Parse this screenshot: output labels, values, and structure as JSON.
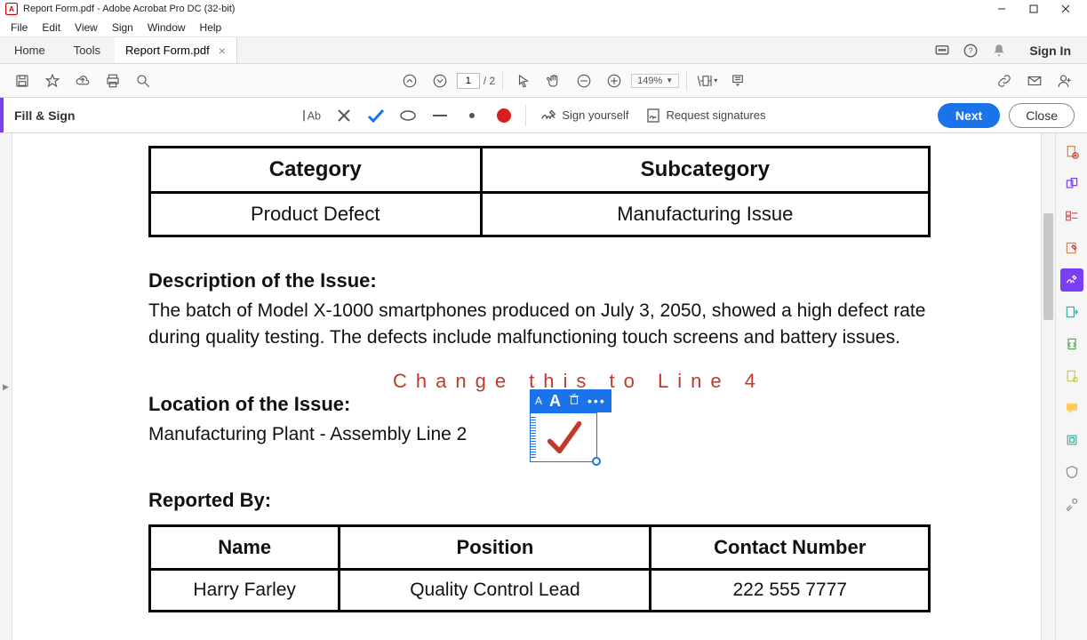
{
  "window": {
    "title": "Report Form.pdf - Adobe Acrobat Pro DC (32-bit)"
  },
  "menu": {
    "file": "File",
    "edit": "Edit",
    "view": "View",
    "sign": "Sign",
    "window": "Window",
    "help": "Help"
  },
  "tabs": {
    "home": "Home",
    "tools": "Tools",
    "doc": "Report Form.pdf",
    "signin": "Sign In"
  },
  "toolbar": {
    "page_current": "1",
    "page_total": "/ 2",
    "zoom": "149%"
  },
  "fillsign": {
    "label": "Fill & Sign",
    "sign_yourself": "Sign yourself",
    "request": "Request signatures",
    "next": "Next",
    "close": "Close"
  },
  "annot": {
    "overlay_text": "Change this to Line 4",
    "small_a": "A",
    "big_a": "A",
    "dots": "•••"
  },
  "doc": {
    "cat_header": "Category",
    "subcat_header": "Subcategory",
    "cat_value": "Product Defect",
    "subcat_value": "Manufacturing Issue",
    "desc_h": "Description of the Issue:",
    "desc_body": "The batch of Model X-1000 smartphones produced on July 3, 2050, showed a high defect rate during quality testing. The defects include malfunctioning touch screens and battery issues.",
    "loc_h": "Location of the Issue:",
    "loc_body": "Manufacturing Plant - Assembly Line 2",
    "rep_h": "Reported By:",
    "rep_headers": {
      "name": "Name",
      "position": "Position",
      "contact": "Contact Number"
    },
    "rep_row": {
      "name": "Harry Farley",
      "position": "Quality Control Lead",
      "contact": "222 555 7777"
    }
  }
}
